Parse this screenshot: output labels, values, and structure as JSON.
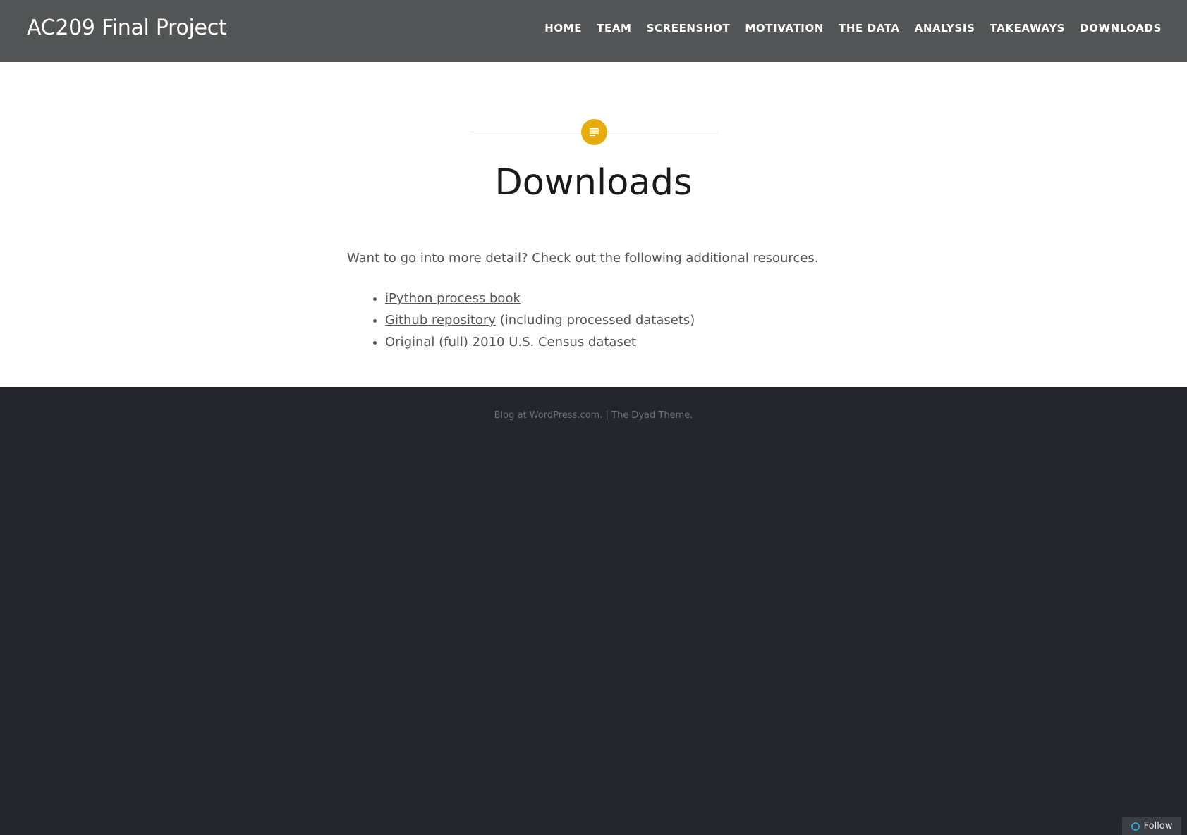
{
  "header": {
    "site_title": "AC209 Final Project",
    "nav": [
      "HOME",
      "TEAM",
      "SCREENSHOT",
      "MOTIVATION",
      "THE DATA",
      "ANALYSIS",
      "TAKEAWAYS",
      "DOWNLOADS"
    ]
  },
  "post": {
    "format_icon": "standard-post-icon",
    "title": "Downloads",
    "intro": "Want to go into more detail? Check out the following additional resources.",
    "resources": [
      {
        "link_text": "iPython process book",
        "suffix": ""
      },
      {
        "link_text": "Github repository",
        "suffix": " (including processed datasets)"
      },
      {
        "link_text": "Original (full) 2010 U.S. Census dataset",
        "suffix": ""
      }
    ]
  },
  "footer": {
    "credit_blog": "Blog at WordPress.com.",
    "separator": " | ",
    "credit_theme": "The Dyad Theme."
  },
  "follow": {
    "label": "Follow"
  },
  "colors": {
    "header_bg": "#525456",
    "footer_bg": "#25262b",
    "accent": "#e6ad0c"
  }
}
